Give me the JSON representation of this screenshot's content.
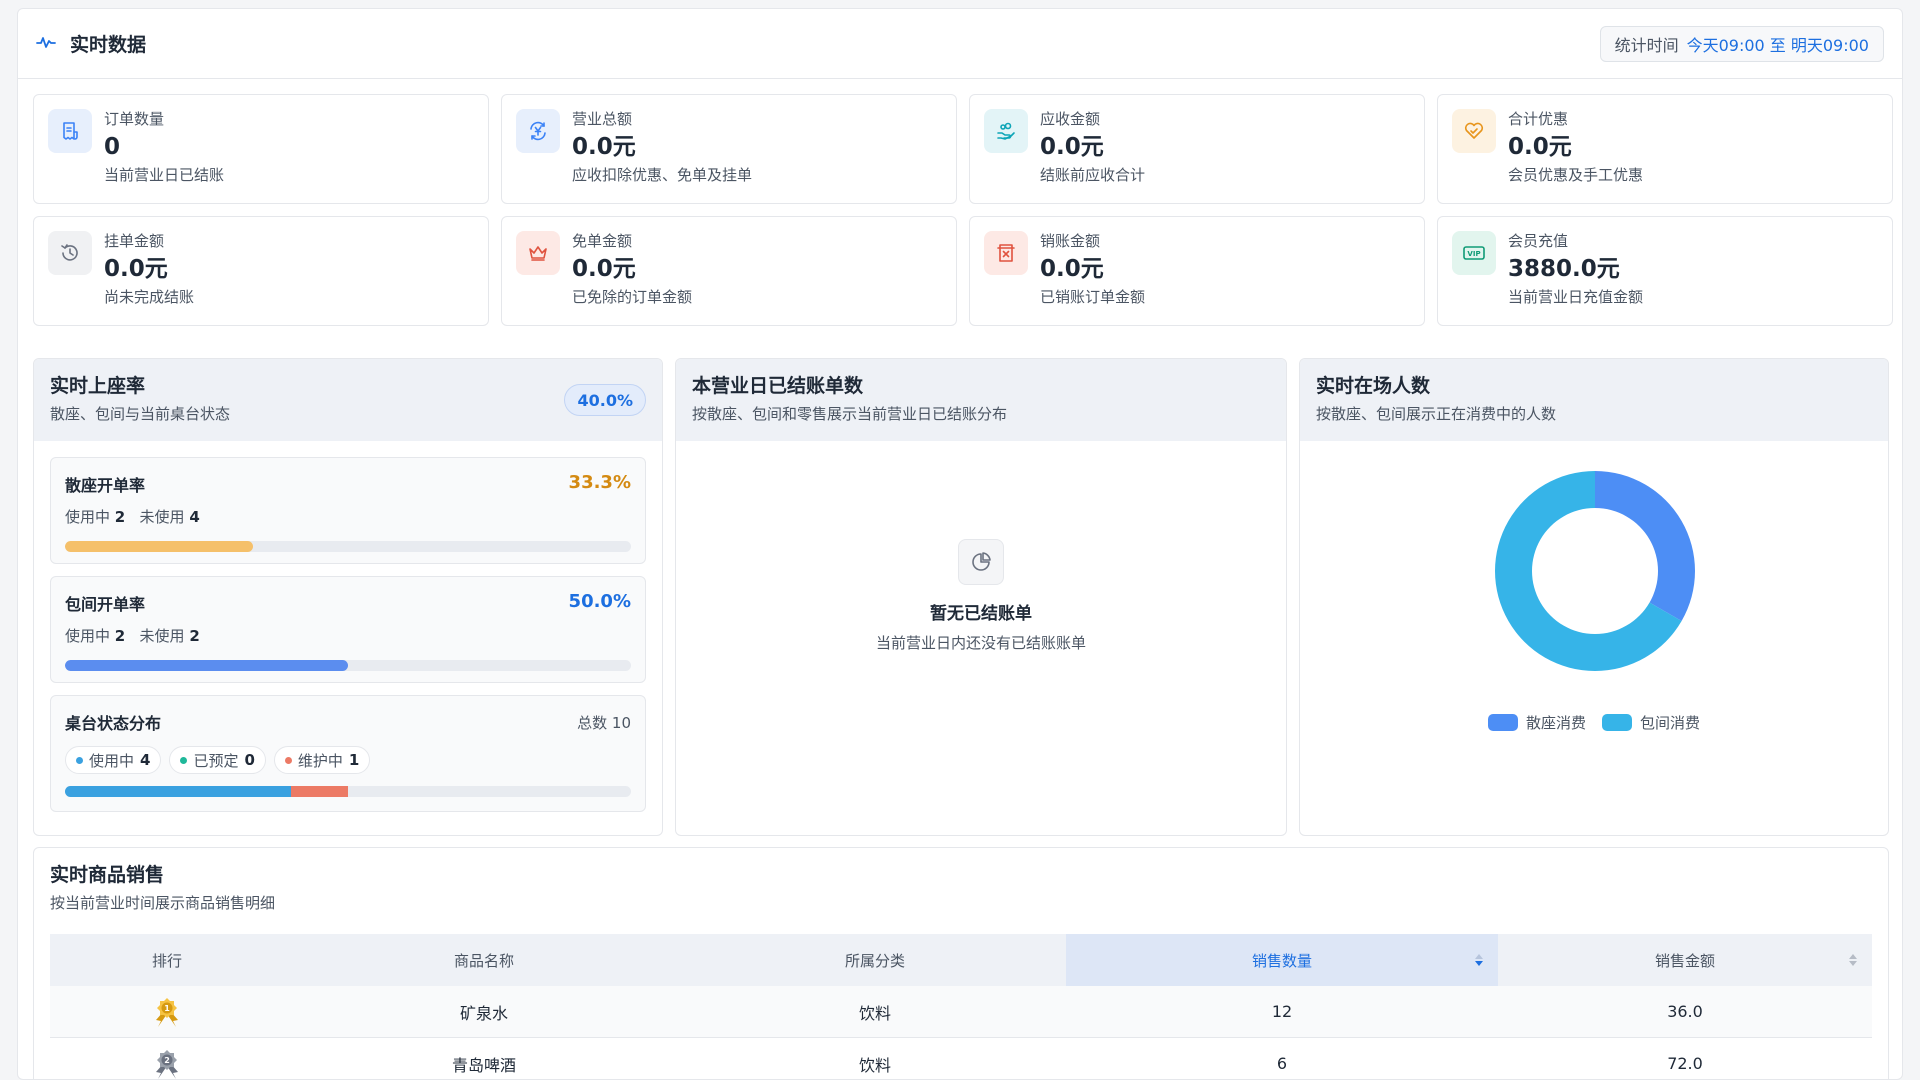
{
  "header": {
    "title": "实时数据",
    "time_label": "统计时间",
    "time_value": "今天09:00 至 明天09:00"
  },
  "stats": [
    {
      "label": "订单数量",
      "value": "0",
      "desc": "当前营业日已结账",
      "icon": "receipt-icon",
      "color": "#3b82f6",
      "bg": "#e7effc"
    },
    {
      "label": "营业总额",
      "value": "0.0元",
      "desc": "应收扣除优惠、免单及挂单",
      "icon": "currency-icon",
      "color": "#3b82f6",
      "bg": "#e7effc"
    },
    {
      "label": "应收金额",
      "value": "0.0元",
      "desc": "结账前应收合计",
      "icon": "hand-coins-icon",
      "color": "#0ea5b7",
      "bg": "#e3f4f7"
    },
    {
      "label": "合计优惠",
      "value": "0.0元",
      "desc": "会员优惠及手工优惠",
      "icon": "heart-tag-icon",
      "color": "#e8951c",
      "bg": "#fdf2e1"
    },
    {
      "label": "挂单金额",
      "value": "0.0元",
      "desc": "尚未完成结账",
      "icon": "history-icon",
      "color": "#6b7280",
      "bg": "#f0f1f3"
    },
    {
      "label": "免单金额",
      "value": "0.0元",
      "desc": "已免除的订单金额",
      "icon": "crown-icon",
      "color": "#e0533f",
      "bg": "#fde9e5"
    },
    {
      "label": "销账金额",
      "value": "0.0元",
      "desc": "已销账订单金额",
      "icon": "delete-receipt-icon",
      "color": "#e0533f",
      "bg": "#fde9e5"
    },
    {
      "label": "会员充值",
      "value": "3880.0元",
      "desc": "当前营业日充值金额",
      "icon": "vip-icon",
      "color": "#0f9b76",
      "bg": "#e2f5ee"
    }
  ],
  "occupancy": {
    "title": "实时上座率",
    "subtitle": "散座、包间与当前桌台状态",
    "rate": "40.0%",
    "hall": {
      "name": "散座开单率",
      "pct": "33.3%",
      "fraction": 0.333,
      "in_use_label": "使用中",
      "in_use": "2",
      "idle_label": "未使用",
      "idle": "4",
      "color": "#f5c06a",
      "pct_color": "#d48a12"
    },
    "room": {
      "name": "包间开单率",
      "pct": "50.0%",
      "fraction": 0.5,
      "in_use_label": "使用中",
      "in_use": "2",
      "idle_label": "未使用",
      "idle": "2",
      "color": "#5b8def",
      "pct_color": "#1d6fe0"
    },
    "status": {
      "name": "桌台状态分布",
      "total_label": "总数 10",
      "total": 10,
      "items": [
        {
          "label": "使用中",
          "count": "4",
          "value": 4,
          "color": "#3aa1e0"
        },
        {
          "label": "已预定",
          "count": "0",
          "value": 0,
          "color": "#1fb89a"
        },
        {
          "label": "维护中",
          "count": "1",
          "value": 1,
          "color": "#ec7a65"
        }
      ]
    }
  },
  "settled": {
    "title": "本营业日已结账单数",
    "subtitle": "按散座、包间和零售展示当前营业日已结账分布",
    "empty_title": "暂无已结账单",
    "empty_sub": "当前营业日内还没有已结账账单"
  },
  "people": {
    "title": "实时在场人数",
    "subtitle": "按散座、包间展示正在消费中的人数"
  },
  "chart_data": {
    "type": "pie",
    "categories": [
      "散座消费",
      "包间消费"
    ],
    "values": [
      2,
      4
    ],
    "colors": [
      "#4d8ef5",
      "#36b4e8"
    ],
    "legend": "bottom"
  },
  "sales": {
    "title": "实时商品销售",
    "subtitle": "按当前营业时间展示商品销售明细",
    "columns": [
      "排行",
      "商品名称",
      "所属分类",
      "销售数量",
      "销售金额"
    ],
    "rows": [
      {
        "rank": "1",
        "name": "矿泉水",
        "category": "饮料",
        "qty": "12",
        "amount": "36.0"
      },
      {
        "rank": "2",
        "name": "青岛啤酒",
        "category": "饮料",
        "qty": "6",
        "amount": "72.0"
      }
    ]
  }
}
